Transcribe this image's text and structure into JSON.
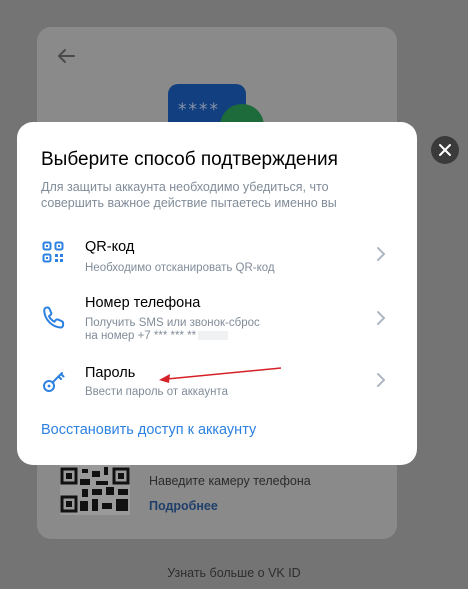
{
  "background": {
    "qr_description": "Наведите камеру телефона",
    "qr_more_link": "Подробнее",
    "learn_more_link": "Узнать больше о VK ID",
    "phone_stars": "****"
  },
  "modal": {
    "title": "Выберите способ подтверждения",
    "subtitle": "Для защиты аккаунта необходимо убедиться, что совершить важное действие пытаетесь именно вы",
    "options": [
      {
        "title": "QR-код",
        "description": "Необходимо отсканировать QR-код",
        "icon": "qr-icon"
      },
      {
        "title": "Номер телефона",
        "description_line1": "Получить SMS или звонок-сброс",
        "description_line2": "на номер +7 *** *** **",
        "icon": "phone-icon"
      },
      {
        "title": "Пароль",
        "description": "Ввести пароль от аккаунта",
        "icon": "key-icon"
      }
    ],
    "restore_link": "Восстановить доступ к аккаунту"
  },
  "colors": {
    "accent": "#2d81e0",
    "secondary_text": "#818c99",
    "annotation_arrow": "#d62027"
  }
}
